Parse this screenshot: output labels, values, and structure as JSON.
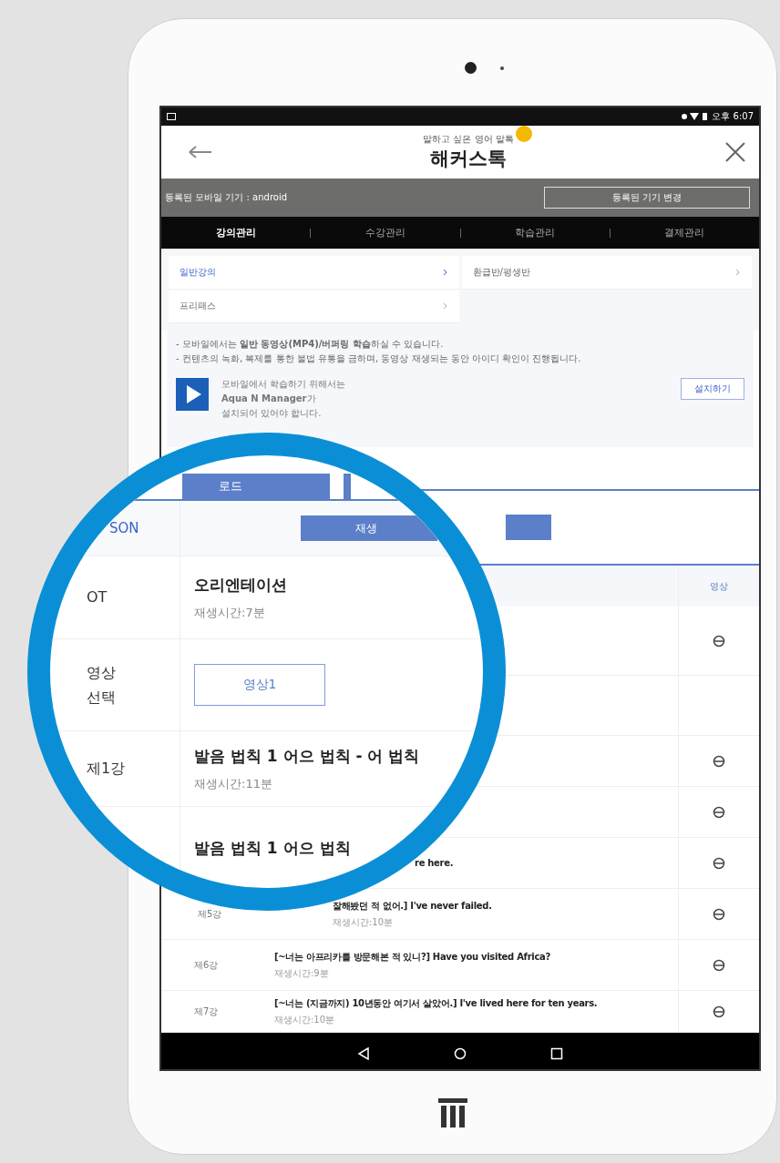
{
  "status_bar": {
    "time": "오후 6:07"
  },
  "header": {
    "logo_tagline": "말하고 싶은 영어 말톡",
    "logo_text": "해커스톡"
  },
  "device_bar": {
    "label": "등록된 모바일 기기 : android",
    "button": "등록된 기기 변경"
  },
  "tabs": [
    {
      "label": "강의관리",
      "selected": true
    },
    {
      "label": "수강관리",
      "selected": false
    },
    {
      "label": "학습관리",
      "selected": false
    },
    {
      "label": "결제관리",
      "selected": false
    }
  ],
  "menu": [
    {
      "label": "일반강의",
      "selected": true
    },
    {
      "label": "환급반/평생반",
      "selected": false
    },
    {
      "label": "프리패스",
      "selected": false
    }
  ],
  "notice": {
    "lines": [
      "- 모바일에서는 **일반 동영상(MP4)/버퍼링 학습**하실 수 있습니다.",
      "- 컨텐츠의 녹화, 복제를 통한 불법 유통을 금하며, 동영상 재생되는 동안 아이디 확인이 진행됩니다."
    ],
    "app_lines": [
      "모바일에서 학습하기 위해서는",
      "**Aqua N Manager**가",
      "설치되어 있어야 합니다."
    ],
    "install_button": "설치하기"
  },
  "table": {
    "video_column": "영상",
    "rows": [
      {
        "kind": "hidden",
        "has_video": true
      },
      {
        "kind": "hidden",
        "has_video": false
      },
      {
        "kind": "hidden",
        "has_video": true
      },
      {
        "kind": "hidden",
        "has_video": true
      },
      {
        "kind": "covered",
        "title": "re here.",
        "has_video": true
      },
      {
        "kind": "partial",
        "lecture": "제5강",
        "title": "잘해봤던 적 없어.] I've never failed.",
        "duration": "재생시간:10분",
        "has_video": true
      },
      {
        "kind": "full",
        "lecture": "제6강",
        "title": "[~너는 아프리카를 방문해본 적 있니?] Have you visited Africa?",
        "duration": "재생시간:9분",
        "has_video": true
      },
      {
        "kind": "full",
        "lecture": "제7강",
        "title": "[~너는 (지금까지) 10년동안 여기서 살았어.] I've lived here for ten years.",
        "duration": "재생시간:10분",
        "has_video": true
      }
    ]
  },
  "magnifier": {
    "top_button": "로드",
    "session_label": "SON",
    "play_button": "재생",
    "rows": [
      {
        "kind": "lecture",
        "lecture": "OT",
        "title": "오리엔테이션",
        "duration": "재생시간:7분"
      },
      {
        "kind": "video-select",
        "lecture": "영상 선택",
        "button": "영상1"
      },
      {
        "kind": "lecture",
        "lecture": "제1강",
        "title": "발음 법칙 1 어으 법칙 - 어 법칙",
        "duration": "재생시간:11분"
      },
      {
        "kind": "lecture",
        "title": "발음 법칙 1 어으 법칙"
      }
    ]
  }
}
